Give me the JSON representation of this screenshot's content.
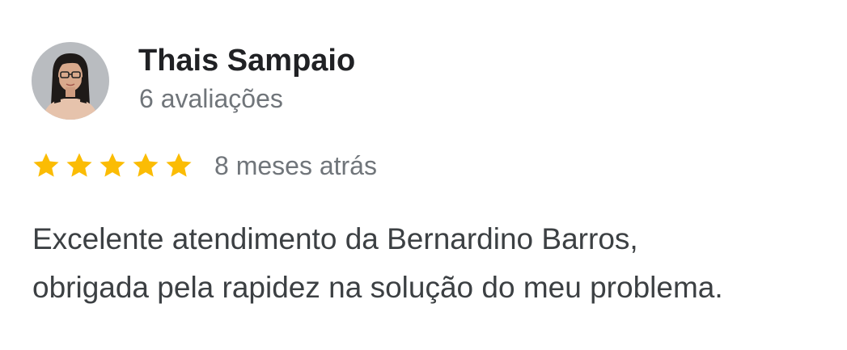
{
  "reviewer": {
    "name": "Thais Sampaio",
    "review_count": "6 avaliações",
    "avatar_icon": "profile-photo"
  },
  "review": {
    "rating": 5,
    "max_rating": 5,
    "star_color": "#fbbc04",
    "date": "8 meses atrás",
    "text_lines": [
      "Excelente atendimento da Bernardino Barros,",
      "obrigada pela rapidez na solução do meu problema."
    ]
  }
}
